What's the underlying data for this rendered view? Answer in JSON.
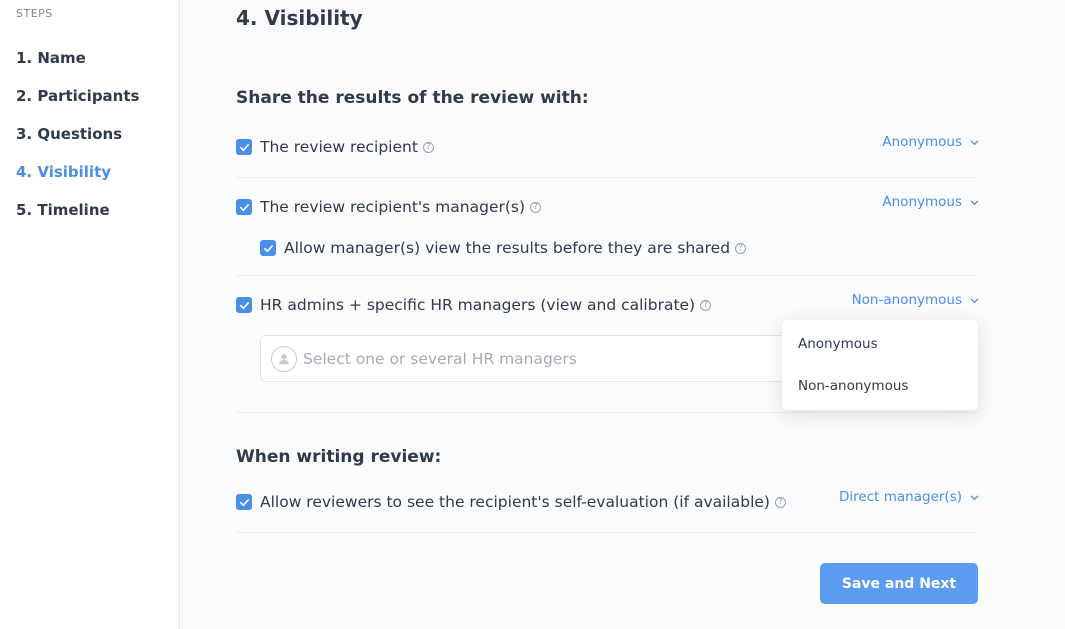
{
  "sidebar": {
    "heading": "STEPS",
    "steps": [
      {
        "label": "1. Name"
      },
      {
        "label": "2. Participants"
      },
      {
        "label": "3. Questions"
      },
      {
        "label": "4. Visibility",
        "active": true
      },
      {
        "label": "5. Timeline"
      }
    ]
  },
  "main": {
    "title": "4. Visibility",
    "share_section": {
      "title": "Share the results of the review with:",
      "recipient": {
        "label": "The review recipient",
        "checked": true,
        "setting": "Anonymous"
      },
      "managers": {
        "label": "The review recipient's manager(s)",
        "checked": true,
        "setting": "Anonymous"
      },
      "managers_preview": {
        "label": "Allow manager(s) view the results before they are shared",
        "checked": true
      },
      "hr": {
        "label": "HR admins + specific HR managers (view and calibrate)",
        "checked": true,
        "setting": "Non-anonymous"
      },
      "hr_select": {
        "placeholder": "Select one or several HR managers"
      }
    },
    "dropdown_menu": {
      "options": [
        "Anonymous",
        "Non-anonymous"
      ]
    },
    "writing_section": {
      "title": "When writing review:",
      "self_eval": {
        "label": "Allow reviewers to see the recipient's self-evaluation (if available)",
        "checked": true,
        "setting": "Direct manager(s)"
      }
    },
    "save_button": "Save and Next"
  },
  "colors": {
    "accent": "#4a8fe7",
    "button": "#5b9bf0",
    "text": "#2f3a4b",
    "muted": "#a5abb7"
  }
}
